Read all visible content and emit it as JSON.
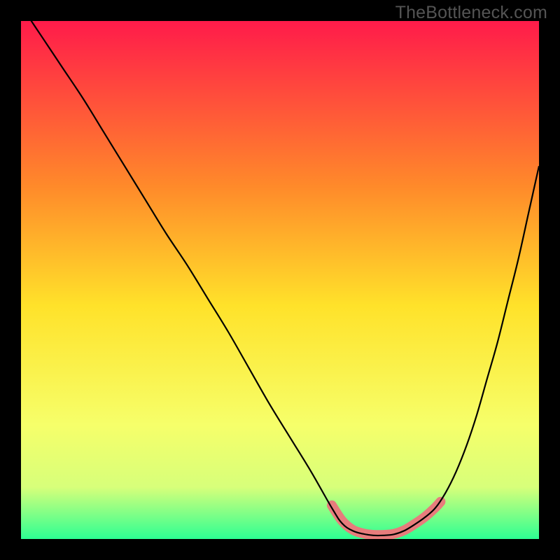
{
  "watermark": "TheBottleneck.com",
  "chart_data": {
    "type": "line",
    "title": "",
    "xlabel": "",
    "ylabel": "",
    "xlim": [
      0,
      100
    ],
    "ylim": [
      0,
      100
    ],
    "legend": false,
    "grid": false,
    "background_gradient": {
      "top": "#ff1b4a",
      "mid_upper": "#ff8a2a",
      "mid": "#ffe22a",
      "mid_lower": "#f6ff6a",
      "lower": "#d7ff7a",
      "bottom": "#2dff93"
    },
    "series": [
      {
        "name": "left_branch",
        "x": [
          0,
          4,
          8,
          12,
          16,
          20,
          24,
          28,
          32,
          36,
          40,
          44,
          48,
          52,
          56,
          60,
          62
        ],
        "y": [
          103,
          97,
          91,
          85,
          78.5,
          72,
          65.5,
          59,
          53,
          46.5,
          40,
          33,
          26,
          19.5,
          13,
          6,
          3
        ]
      },
      {
        "name": "valley",
        "x": [
          62,
          64,
          66,
          68,
          70,
          72,
          74,
          76,
          78,
          80
        ],
        "y": [
          3,
          1.6,
          1.0,
          0.7,
          0.7,
          0.9,
          1.6,
          2.8,
          4.2,
          6
        ]
      },
      {
        "name": "right_branch",
        "x": [
          80,
          82,
          84,
          86,
          88,
          90,
          92,
          94,
          96,
          98,
          100
        ],
        "y": [
          6,
          9,
          13,
          18,
          24,
          31,
          38,
          46,
          54,
          63,
          72
        ]
      }
    ],
    "highlight_segment": {
      "name": "valley_marker",
      "color": "#e77c7c",
      "x": [
        60,
        62,
        64,
        66,
        68,
        70,
        72,
        74,
        76,
        78,
        80,
        81
      ],
      "y": [
        6.5,
        3.5,
        1.8,
        1.1,
        0.8,
        0.8,
        1.0,
        1.7,
        2.9,
        4.3,
        6.1,
        7.2
      ]
    }
  }
}
